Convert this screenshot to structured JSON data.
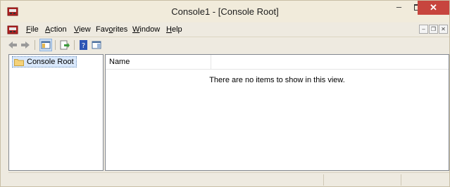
{
  "window": {
    "title": "Console1 - [Console Root]",
    "controls": {
      "minimize": "–",
      "maximize": "□",
      "close": "✕"
    }
  },
  "menubar": {
    "items": [
      {
        "pre": "",
        "u": "F",
        "post": "ile"
      },
      {
        "pre": "",
        "u": "A",
        "post": "ction"
      },
      {
        "pre": "",
        "u": "V",
        "post": "iew"
      },
      {
        "pre": "Fav",
        "u": "o",
        "post": "rites"
      },
      {
        "pre": "",
        "u": "W",
        "post": "indow"
      },
      {
        "pre": "",
        "u": "H",
        "post": "elp"
      }
    ],
    "mdi": {
      "minimize": "–",
      "restore": "❐",
      "close": "✕"
    }
  },
  "toolbar": {
    "icons": [
      "back-arrow-icon",
      "forward-arrow-icon",
      "show-hide-tree-icon",
      "export-list-icon",
      "help-icon",
      "show-hide-action-pane-icon"
    ]
  },
  "tree": {
    "root_label": "Console Root"
  },
  "list": {
    "columns": [
      "Name"
    ],
    "empty_message": "There are no items to show in this view."
  },
  "colors": {
    "title_bg": "#f1ebdb",
    "close_button": "#c7453e",
    "selection": "#d9e8fb",
    "pane_border": "#828790"
  }
}
